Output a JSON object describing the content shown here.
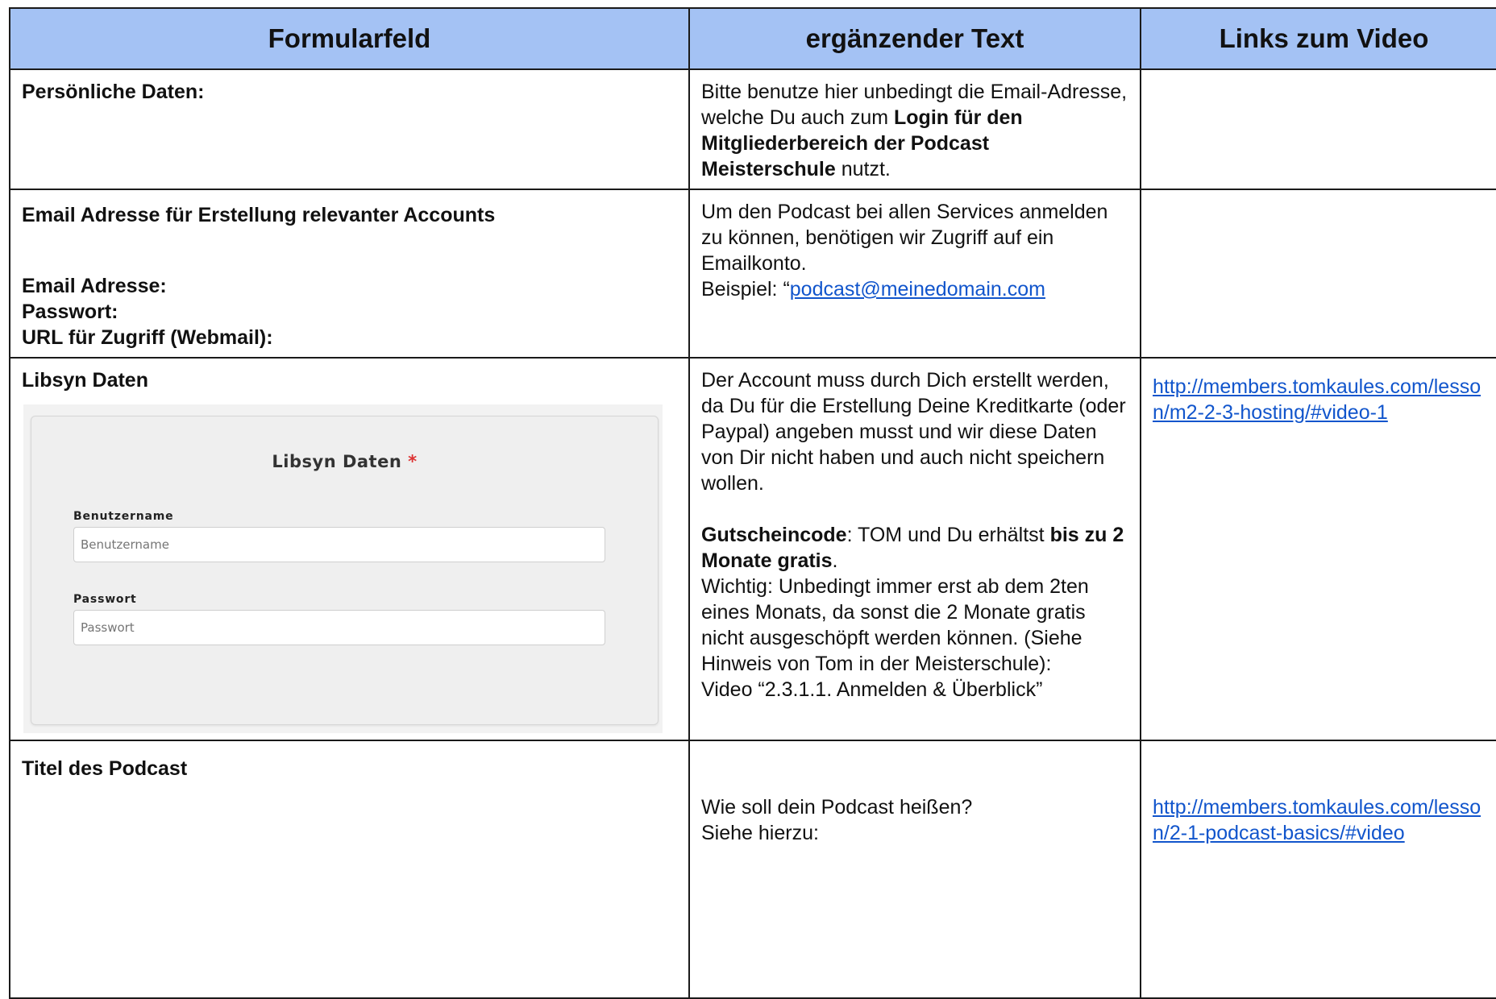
{
  "header": {
    "col1": "Formularfeld",
    "col2": "ergänzender Text",
    "col3": "Links zum Video"
  },
  "rows": [
    {
      "field": "Persönliche Daten:",
      "text": {
        "part1": "Bitte benutze hier unbedingt die Email-Adresse, welche Du auch zum ",
        "bold": "Login für den Mitgliederbereich der Podcast Meisterschule",
        "part2": " nutzt."
      },
      "link": ""
    },
    {
      "field": "Email Adresse für Erstellung relevanter Accounts",
      "subfields": [
        "Email Adresse:",
        "Passwort:",
        "URL für Zugriff (Webmail):"
      ],
      "text": {
        "line1": "Um den Podcast bei allen Services anmelden zu können, benötigen wir Zugriff auf ein Emailkonto.",
        "example_prefix": "Beispiel: “",
        "example_link": "podcast@meinedomain.com"
      },
      "link": ""
    },
    {
      "field": "Libsyn Daten",
      "screenshot": {
        "title": "Libsyn Daten",
        "required_mark": "*",
        "username_label": "Benutzername",
        "username_placeholder": "Benutzername",
        "password_label": "Passwort",
        "password_placeholder": "Passwort"
      },
      "text": {
        "p1": "Der Account muss durch Dich erstellt werden, da Du für die Erstellung Deine Kreditkarte (oder Paypal) angeben musst und wir diese Daten von Dir nicht haben und auch nicht speichern wollen.",
        "voucher_label": "Gutscheincode",
        "voucher_rest": ": TOM und Du erhältst ",
        "voucher_bold": "bis zu 2 Monate gratis",
        "voucher_end": ".",
        "p3": "Wichtig: Unbedingt immer erst ab dem 2ten eines Monats, da sonst die 2 Monate gratis nicht ausgeschöpft werden können. (Siehe Hinweis von Tom in der Meisterschule):",
        "p4": "Video “2.3.1.1. Anmelden & Überblick”"
      },
      "link": "http://members.tomkaules.com/lesson/m2-2-3-hosting/#video-1"
    },
    {
      "field": "Titel des Podcast",
      "text": {
        "line1": "Wie soll dein Podcast heißen?",
        "line2": "Siehe hierzu:"
      },
      "link": "http://members.tomkaules.com/lesson/2-1-podcast-basics/#video"
    }
  ],
  "colors": {
    "header_bg": "#a4c2f4",
    "link": "#1155cc",
    "required": "#dd3333"
  }
}
